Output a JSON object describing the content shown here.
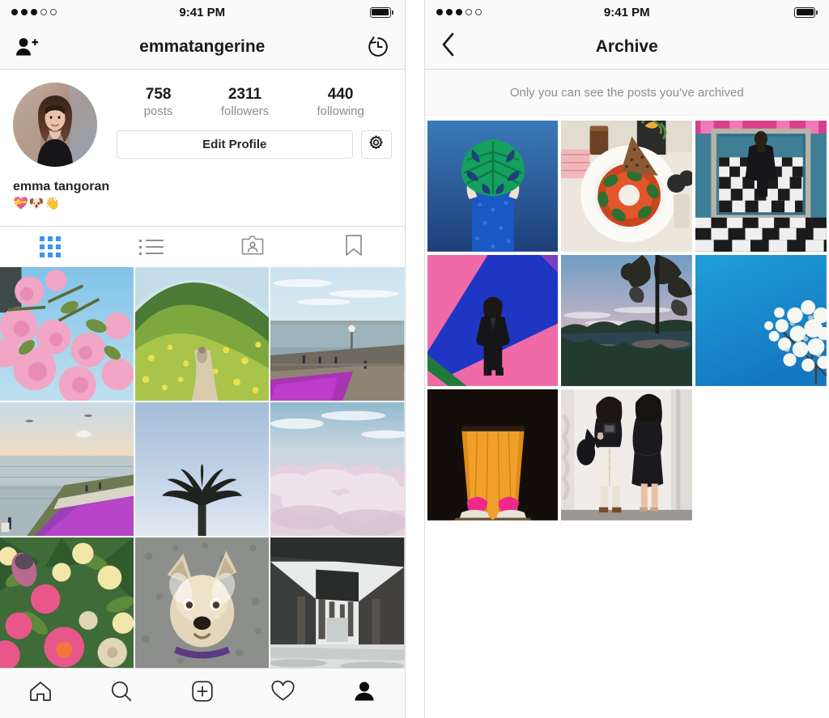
{
  "colors": {
    "accent_blue": "#3897f0",
    "text_primary": "#262626",
    "text_secondary": "#8e8e8e",
    "chrome_bg": "#fafafa",
    "border": "#dbdbdb"
  },
  "profile_screen": {
    "status_bar": {
      "time": "9:41 PM",
      "signal_dots_filled": 3,
      "signal_dots_total": 5,
      "battery_icon": "battery-full-icon"
    },
    "nav": {
      "left_icon": "add-person-icon",
      "title": "emmatangerine",
      "right_icon": "archive-history-icon"
    },
    "avatar": "profile-avatar",
    "stats": [
      {
        "value": "758",
        "label": "posts"
      },
      {
        "value": "2311",
        "label": "followers"
      },
      {
        "value": "440",
        "label": "following"
      }
    ],
    "edit_profile_label": "Edit Profile",
    "settings_icon": "gear-icon",
    "bio": {
      "name": "emma tangoran",
      "emoji": "💝🐶👋"
    },
    "tabs": [
      {
        "icon": "grid-icon",
        "name": "tab-grid",
        "active": true
      },
      {
        "icon": "list-icon",
        "name": "tab-list",
        "active": false
      },
      {
        "icon": "tagged-icon",
        "name": "tab-tagged",
        "active": false
      },
      {
        "icon": "bookmark-icon",
        "name": "tab-saved",
        "active": false
      }
    ],
    "posts": [
      {
        "alt": "pink cherry blossoms against blue sky"
      },
      {
        "alt": "green hillside trail with yellow wildflowers"
      },
      {
        "alt": "bay waterfront walkway with city skyline"
      },
      {
        "alt": "seagull over ocean at sunset with purple ice plant"
      },
      {
        "alt": "palm tree silhouette against blue sky"
      },
      {
        "alt": "pink clouds seen from above"
      },
      {
        "alt": "bouquet of protea and pink peonies"
      },
      {
        "alt": "scruffy terrier dog looking up"
      },
      {
        "alt": "underside of a wooden pier in fog"
      }
    ],
    "bottom_tabs": [
      {
        "icon": "home-icon",
        "name": "tabbar-home",
        "active": false
      },
      {
        "icon": "search-icon",
        "name": "tabbar-search",
        "active": false
      },
      {
        "icon": "add-post-icon",
        "name": "tabbar-add",
        "active": false
      },
      {
        "icon": "heart-icon",
        "name": "tabbar-activity",
        "active": false
      },
      {
        "icon": "person-icon",
        "name": "tabbar-profile",
        "active": true
      }
    ]
  },
  "archive_screen": {
    "status_bar": {
      "time": "9:41 PM",
      "signal_dots_filled": 3,
      "signal_dots_total": 5,
      "battery_icon": "battery-full-icon"
    },
    "nav": {
      "back_icon": "chevron-left-icon",
      "title": "Archive"
    },
    "note": "Only you can see the posts you've archived",
    "posts": [
      {
        "alt": "person holding monstera leaf over face, navy wall"
      },
      {
        "alt": "brunch plate of shakshuka with seeded toast and coffee"
      },
      {
        "alt": "mirror selfie on black and white checkered floor"
      },
      {
        "alt": "woman in black against pink and blue diagonal wall"
      },
      {
        "alt": "lake at dusk reflecting trees and pink sky"
      },
      {
        "alt": "white blossom branch against bright blue sky"
      },
      {
        "alt": "pink shoes on orange lit floor in dark room"
      },
      {
        "alt": "two women in black taking mirror photo"
      }
    ],
    "empty_cell_count": 1
  }
}
